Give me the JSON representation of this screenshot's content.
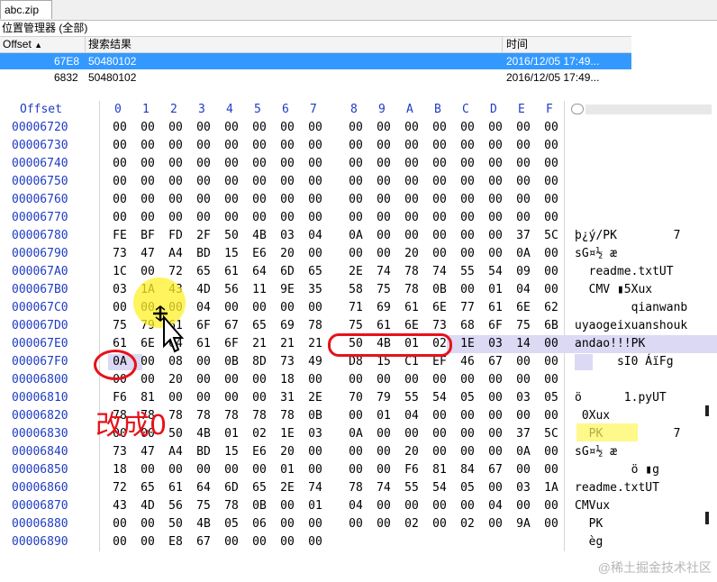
{
  "tabs": [
    {
      "label": "abc.zip"
    }
  ],
  "position_manager": {
    "title": "位置管理器 (全部)",
    "columns": {
      "offset": "Offset",
      "result": "搜索结果",
      "time": "时间"
    },
    "rows": [
      {
        "offset": "67E8",
        "result": "50480102",
        "time": "2016/12/05  17:49...",
        "selected": true
      },
      {
        "offset": "6832",
        "result": "50480102",
        "time": "2016/12/05  17:49...",
        "selected": false
      }
    ]
  },
  "hex": {
    "offset_label": "Offset",
    "col_headers": [
      "0",
      "1",
      "2",
      "3",
      "4",
      "5",
      "6",
      "7",
      "8",
      "9",
      "A",
      "B",
      "C",
      "D",
      "E",
      "F"
    ],
    "rows": [
      {
        "offset": "00006720",
        "bytes": [
          "00",
          "00",
          "00",
          "00",
          "00",
          "00",
          "00",
          "00",
          "00",
          "00",
          "00",
          "00",
          "00",
          "00",
          "00",
          "00"
        ],
        "ascii": ""
      },
      {
        "offset": "00006730",
        "bytes": [
          "00",
          "00",
          "00",
          "00",
          "00",
          "00",
          "00",
          "00",
          "00",
          "00",
          "00",
          "00",
          "00",
          "00",
          "00",
          "00"
        ],
        "ascii": ""
      },
      {
        "offset": "00006740",
        "bytes": [
          "00",
          "00",
          "00",
          "00",
          "00",
          "00",
          "00",
          "00",
          "00",
          "00",
          "00",
          "00",
          "00",
          "00",
          "00",
          "00"
        ],
        "ascii": ""
      },
      {
        "offset": "00006750",
        "bytes": [
          "00",
          "00",
          "00",
          "00",
          "00",
          "00",
          "00",
          "00",
          "00",
          "00",
          "00",
          "00",
          "00",
          "00",
          "00",
          "00"
        ],
        "ascii": ""
      },
      {
        "offset": "00006760",
        "bytes": [
          "00",
          "00",
          "00",
          "00",
          "00",
          "00",
          "00",
          "00",
          "00",
          "00",
          "00",
          "00",
          "00",
          "00",
          "00",
          "00"
        ],
        "ascii": ""
      },
      {
        "offset": "00006770",
        "bytes": [
          "00",
          "00",
          "00",
          "00",
          "00",
          "00",
          "00",
          "00",
          "00",
          "00",
          "00",
          "00",
          "00",
          "00",
          "00",
          "00"
        ],
        "ascii": ""
      },
      {
        "offset": "00006780",
        "bytes": [
          "FE",
          "BF",
          "FD",
          "2F",
          "50",
          "4B",
          "03",
          "04",
          "0A",
          "00",
          "00",
          "00",
          "00",
          "00",
          "37",
          "5C"
        ],
        "ascii": "þ¿ý/PK        7"
      },
      {
        "offset": "00006790",
        "bytes": [
          "73",
          "47",
          "A4",
          "BD",
          "15",
          "E6",
          "20",
          "00",
          "00",
          "00",
          "20",
          "00",
          "00",
          "00",
          "0A",
          "00"
        ],
        "ascii": "sG¤½ æ"
      },
      {
        "offset": "000067A0",
        "bytes": [
          "1C",
          "00",
          "72",
          "65",
          "61",
          "64",
          "6D",
          "65",
          "2E",
          "74",
          "78",
          "74",
          "55",
          "54",
          "09",
          "00"
        ],
        "ascii": "  readme.txtUT"
      },
      {
        "offset": "000067B0",
        "bytes": [
          "03",
          "1A",
          "43",
          "4D",
          "56",
          "11",
          "9E",
          "35",
          "58",
          "75",
          "78",
          "0B",
          "00",
          "01",
          "04",
          "00"
        ],
        "ascii": "  CMV ▮5Xux"
      },
      {
        "offset": "000067C0",
        "bytes": [
          "00",
          "00",
          "00",
          "04",
          "00",
          "00",
          "00",
          "00",
          "71",
          "69",
          "61",
          "6E",
          "77",
          "61",
          "6E",
          "62"
        ],
        "ascii": "        qianwanb"
      },
      {
        "offset": "000067D0",
        "bytes": [
          "75",
          "79",
          "61",
          "6F",
          "67",
          "65",
          "69",
          "78",
          "75",
          "61",
          "6E",
          "73",
          "68",
          "6F",
          "75",
          "6B"
        ],
        "ascii": "uyaogeixuanshouk"
      },
      {
        "offset": "000067E0",
        "bytes": [
          "61",
          "6E",
          "64",
          "61",
          "6F",
          "21",
          "21",
          "21",
          "50",
          "4B",
          "01",
          "02",
          "1E",
          "03",
          "14",
          "00"
        ],
        "ascii": "andao!!!PK"
      },
      {
        "offset": "000067F0",
        "bytes": [
          "0A",
          "00",
          "08",
          "00",
          "0B",
          "8D",
          "73",
          "49",
          "D8",
          "15",
          "C1",
          "EF",
          "46",
          "67",
          "00",
          "00"
        ],
        "ascii": "      sI0 ÁïFg"
      },
      {
        "offset": "00006800",
        "bytes": [
          "00",
          "00",
          "20",
          "00",
          "00",
          "00",
          "18",
          "00",
          "00",
          "00",
          "00",
          "00",
          "00",
          "00",
          "00",
          "00"
        ],
        "ascii": ""
      },
      {
        "offset": "00006810",
        "bytes": [
          "F6",
          "81",
          "00",
          "00",
          "00",
          "00",
          "31",
          "2E",
          "70",
          "79",
          "55",
          "54",
          "05",
          "00",
          "03",
          "05"
        ],
        "ascii": "ö      1.pyUT"
      },
      {
        "offset": "00006820",
        "bytes": [
          "78",
          "78",
          "78",
          "78",
          "78",
          "78",
          "78",
          "0B",
          "00",
          "01",
          "04",
          "00",
          "00",
          "00",
          "00",
          "00"
        ],
        "ascii": " 0Xux"
      },
      {
        "offset": "00006830",
        "bytes": [
          "00",
          "00",
          "50",
          "4B",
          "01",
          "02",
          "1E",
          "03",
          "0A",
          "00",
          "00",
          "00",
          "00",
          "00",
          "37",
          "5C"
        ],
        "ascii": "  PK          7"
      },
      {
        "offset": "00006840",
        "bytes": [
          "73",
          "47",
          "A4",
          "BD",
          "15",
          "E6",
          "20",
          "00",
          "00",
          "00",
          "20",
          "00",
          "00",
          "00",
          "0A",
          "00"
        ],
        "ascii": "sG¤½ æ"
      },
      {
        "offset": "00006850",
        "bytes": [
          "18",
          "00",
          "00",
          "00",
          "00",
          "00",
          "01",
          "00",
          "00",
          "00",
          "F6",
          "81",
          "84",
          "67",
          "00",
          "00"
        ],
        "ascii": "        ö ▮g"
      },
      {
        "offset": "00006860",
        "bytes": [
          "72",
          "65",
          "61",
          "64",
          "6D",
          "65",
          "2E",
          "74",
          "78",
          "74",
          "55",
          "54",
          "05",
          "00",
          "03",
          "1A"
        ],
        "ascii": "readme.txtUT"
      },
      {
        "offset": "00006870",
        "bytes": [
          "43",
          "4D",
          "56",
          "75",
          "78",
          "0B",
          "00",
          "01",
          "04",
          "00",
          "00",
          "00",
          "00",
          "04",
          "00",
          "00"
        ],
        "ascii": "CMVux"
      },
      {
        "offset": "00006880",
        "bytes": [
          "00",
          "00",
          "50",
          "4B",
          "05",
          "06",
          "00",
          "00",
          "00",
          "00",
          "02",
          "00",
          "02",
          "00",
          "9A",
          "00"
        ],
        "ascii": "  PK"
      },
      {
        "offset": "00006890",
        "bytes": [
          "00",
          "00",
          "E8",
          "67",
          "00",
          "00",
          "00",
          "00",
          "",
          "",
          "",
          "",
          "",
          "",
          "",
          ""
        ],
        "ascii": "  èg"
      }
    ]
  },
  "annotation": {
    "text": "改成0"
  },
  "watermark": "@稀土掘金技术社区",
  "colors": {
    "offset_blue": "#1f3cc4",
    "selection_blue": "#3399ff",
    "annotation_red": "#e6121b",
    "highlight_yellow": "#fff028"
  }
}
